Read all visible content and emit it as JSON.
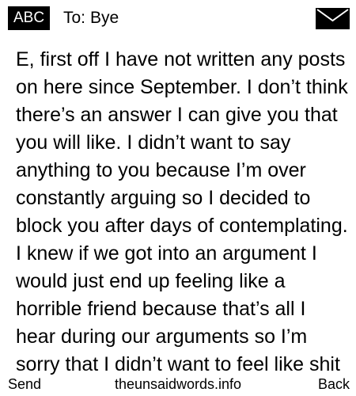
{
  "header": {
    "input_mode": "ABC",
    "recipient_label": "To:",
    "recipient_name": "Bye",
    "icon": "envelope-icon"
  },
  "message": {
    "body": "E, first off I have not written any posts on here since September. I don’t think there’s an answer I can give you that you will like. I didn’t want to say anything to you because I’m over constantly arguing so I decided to block you after days of contemplating. I knew if we got into an argument I would just end up feeling like a horrible friend because that’s all I hear during our arguments so I’m sorry that I didn’t want to feel like shit"
  },
  "softkeys": {
    "left": "Send",
    "center": "theunsaidwords.info",
    "right": "Back"
  },
  "colors": {
    "background": "#ffffff",
    "text": "#000000",
    "badge_background": "#000000",
    "badge_text": "#ffffff"
  }
}
